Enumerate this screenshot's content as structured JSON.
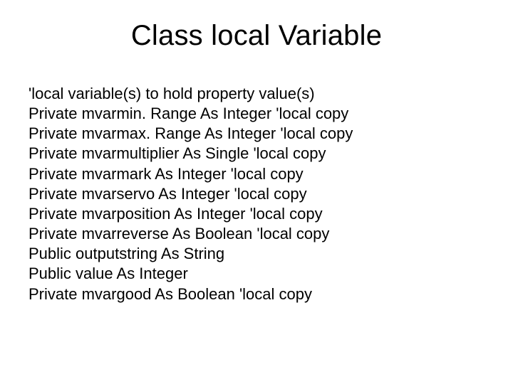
{
  "title": "Class local Variable",
  "lines": [
    "'local variable(s) to hold property value(s)",
    "Private mvarmin. Range As Integer 'local copy",
    "Private mvarmax. Range As Integer 'local copy",
    "Private mvarmultiplier As Single 'local copy",
    "Private mvarmark As Integer 'local copy",
    "Private mvarservo As Integer 'local copy",
    "Private mvarposition As Integer 'local copy",
    "Private mvarreverse As Boolean 'local copy",
    "Public outputstring As String",
    "Public value As Integer",
    "Private mvargood As Boolean 'local copy"
  ]
}
